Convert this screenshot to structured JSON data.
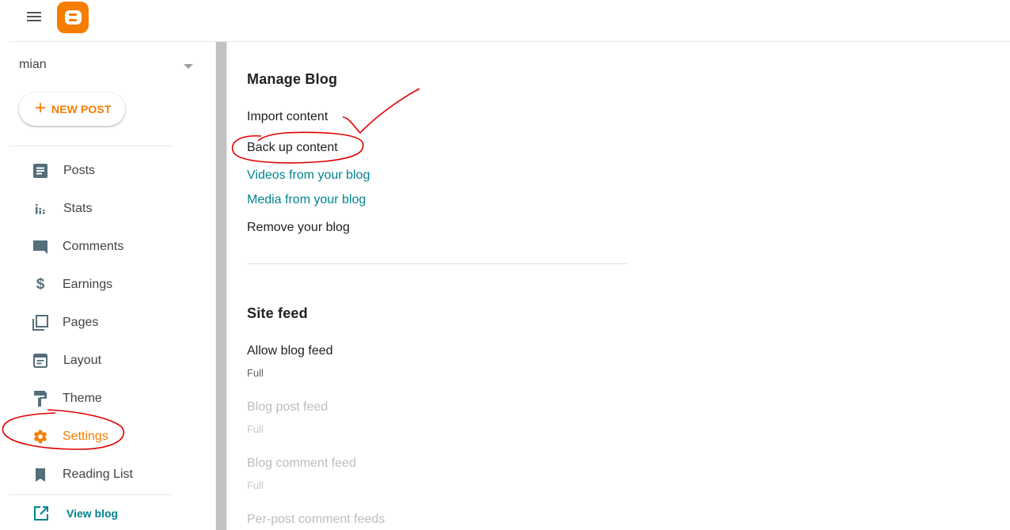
{
  "header": {
    "menu_icon": "hamburger-menu-icon",
    "logo_icon": "blogger-logo-icon"
  },
  "sidebar": {
    "blog_name": "mian",
    "new_post_label": "NEW POST",
    "items": [
      {
        "label": "Posts",
        "icon": "posts-icon"
      },
      {
        "label": "Stats",
        "icon": "stats-icon"
      },
      {
        "label": "Comments",
        "icon": "comments-icon"
      },
      {
        "label": "Earnings",
        "icon": "dollar-icon"
      },
      {
        "label": "Pages",
        "icon": "pages-icon"
      },
      {
        "label": "Layout",
        "icon": "layout-icon"
      },
      {
        "label": "Theme",
        "icon": "paint-roller-icon"
      },
      {
        "label": "Settings",
        "icon": "gear-icon",
        "active": true
      },
      {
        "label": "Reading List",
        "icon": "bookmark-icon"
      }
    ],
    "view_blog_label": "View blog"
  },
  "main": {
    "manage_blog": {
      "title": "Manage Blog",
      "items": [
        {
          "label": "Import content",
          "type": "action"
        },
        {
          "label": "Back up content",
          "type": "action"
        },
        {
          "label": "Videos from your blog",
          "type": "link"
        },
        {
          "label": "Media from your blog",
          "type": "link"
        },
        {
          "label": "Remove your blog",
          "type": "action"
        }
      ]
    },
    "site_feed": {
      "title": "Site feed",
      "settings": [
        {
          "label": "Allow blog feed",
          "value": "Full",
          "enabled": true
        },
        {
          "label": "Blog post feed",
          "value": "Full",
          "enabled": false
        },
        {
          "label": "Blog comment feed",
          "value": "Full",
          "enabled": false
        },
        {
          "label": "Per-post comment feeds",
          "value": "",
          "enabled": false
        }
      ]
    }
  },
  "colors": {
    "accent": "#f57d00",
    "link": "#00838f",
    "icon": "#546e7a",
    "annotation": "#e00000"
  }
}
